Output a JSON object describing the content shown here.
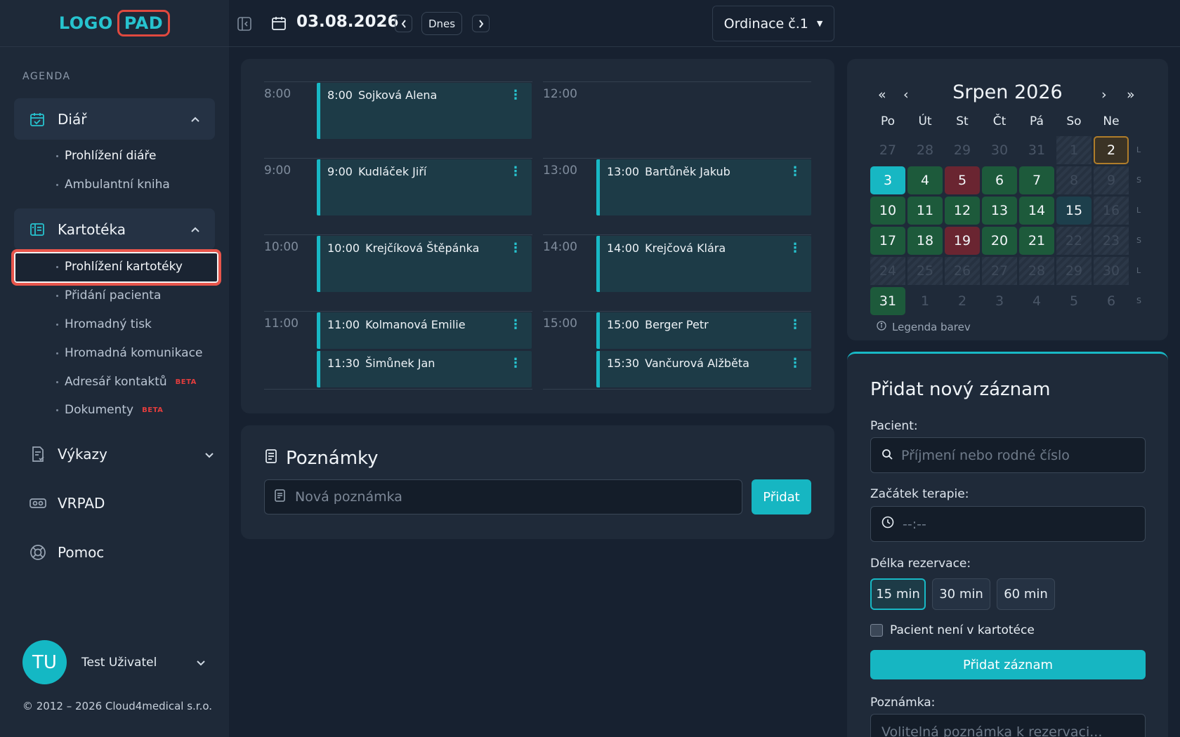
{
  "brand": {
    "logo_a": "LOGO",
    "logo_b": "PAD"
  },
  "sidebar": {
    "section_label": "AGENDA",
    "groups": [
      {
        "title": "Diář",
        "items": [
          "Prohlížení diáře",
          "Ambulantní kniha"
        ]
      },
      {
        "title": "Kartotéka",
        "items": [
          "Prohlížení kartotéky",
          "Přidání pacienta",
          "Hromadný tisk",
          "Hromadná komunikace",
          "Adresář kontaktů",
          "Dokumenty"
        ]
      }
    ],
    "beta_label": "BETA",
    "nav": [
      "Výkazy",
      "VRPAD",
      "Pomoc"
    ],
    "user": {
      "initials": "TU",
      "name": "Test Uživatel"
    },
    "copyright": "© 2012 – 2026 Cloud4medical s.r.o."
  },
  "topbar": {
    "date": "03.08.2026",
    "today_label": "Dnes",
    "room": "Ordinace č.1"
  },
  "schedule": {
    "times_left": [
      "8:00",
      "9:00",
      "10:00",
      "11:00"
    ],
    "times_right": [
      "12:00",
      "13:00",
      "14:00",
      "15:00"
    ],
    "appointments": [
      {
        "time": "8:00",
        "name": "Sojková Alena"
      },
      {
        "time": "9:00",
        "name": "Kudláček Jiří"
      },
      {
        "time": "10:00",
        "name": "Krejčíková Štěpánka"
      },
      {
        "time": "11:00",
        "name": "Kolmanová Emilie"
      },
      {
        "time": "11:30",
        "name": "Šimůnek Jan"
      },
      {
        "time": "13:00",
        "name": "Bartůněk Jakub"
      },
      {
        "time": "14:00",
        "name": "Krejčová Klára"
      },
      {
        "time": "15:00",
        "name": "Berger Petr"
      },
      {
        "time": "15:30",
        "name": "Vančurová Alžběta"
      }
    ]
  },
  "notes": {
    "title": "Poznámky",
    "placeholder": "Nová poznámka",
    "add_label": "Přidat"
  },
  "calendar": {
    "title": "Srpen 2026",
    "nav": {
      "first": "«",
      "prev": "‹",
      "next": "›",
      "last": "»"
    },
    "weekdays": [
      "Po",
      "Út",
      "St",
      "Čt",
      "Pá",
      "So",
      "Ne"
    ],
    "week_letters": [
      "L",
      "S",
      "L",
      "S",
      "L",
      "S"
    ],
    "weeks": [
      [
        [
          "27",
          "muted"
        ],
        [
          "28",
          "muted"
        ],
        [
          "29",
          "muted"
        ],
        [
          "30",
          "muted"
        ],
        [
          "31",
          "muted"
        ],
        [
          "1",
          "off"
        ],
        [
          "2",
          "today"
        ]
      ],
      [
        [
          "3",
          "teal"
        ],
        [
          "4",
          "green"
        ],
        [
          "5",
          "red"
        ],
        [
          "6",
          "green"
        ],
        [
          "7",
          "green"
        ],
        [
          "8",
          "off"
        ],
        [
          "9",
          "off"
        ]
      ],
      [
        [
          "10",
          "green"
        ],
        [
          "11",
          "green"
        ],
        [
          "12",
          "green"
        ],
        [
          "13",
          "green"
        ],
        [
          "14",
          "green"
        ],
        [
          "15",
          "blue"
        ],
        [
          "16",
          "off"
        ]
      ],
      [
        [
          "17",
          "green"
        ],
        [
          "18",
          "green"
        ],
        [
          "19",
          "red"
        ],
        [
          "20",
          "green"
        ],
        [
          "21",
          "green"
        ],
        [
          "22",
          "off"
        ],
        [
          "23",
          "off"
        ]
      ],
      [
        [
          "24",
          "off"
        ],
        [
          "25",
          "off"
        ],
        [
          "26",
          "off"
        ],
        [
          "27",
          "off"
        ],
        [
          "28",
          "off"
        ],
        [
          "29",
          "off"
        ],
        [
          "30",
          "off"
        ]
      ],
      [
        [
          "31",
          "green"
        ],
        [
          "1",
          "muted"
        ],
        [
          "2",
          "muted"
        ],
        [
          "3",
          "muted"
        ],
        [
          "4",
          "muted"
        ],
        [
          "5",
          "muted"
        ],
        [
          "6",
          "muted"
        ]
      ]
    ],
    "legend": "Legenda barev"
  },
  "add_record": {
    "title": "Přidat nový záznam",
    "patient_label": "Pacient:",
    "patient_placeholder": "Příjmení nebo rodné číslo",
    "start_label": "Začátek terapie:",
    "start_value": "--:--",
    "length_label": "Délka rezervace:",
    "lengths": [
      "15 min",
      "30 min",
      "60 min"
    ],
    "not_in_records": "Pacient není v kartotéce",
    "submit": "Přidat záznam",
    "note_label": "Poznámka:",
    "note_placeholder": "Volitelná poznámka k rezervaci..."
  },
  "colors": {
    "accent": "#16b6c2",
    "highlight": "#e8554b",
    "day_ok": "#1d5a3b",
    "day_busy": "#6a2531"
  }
}
